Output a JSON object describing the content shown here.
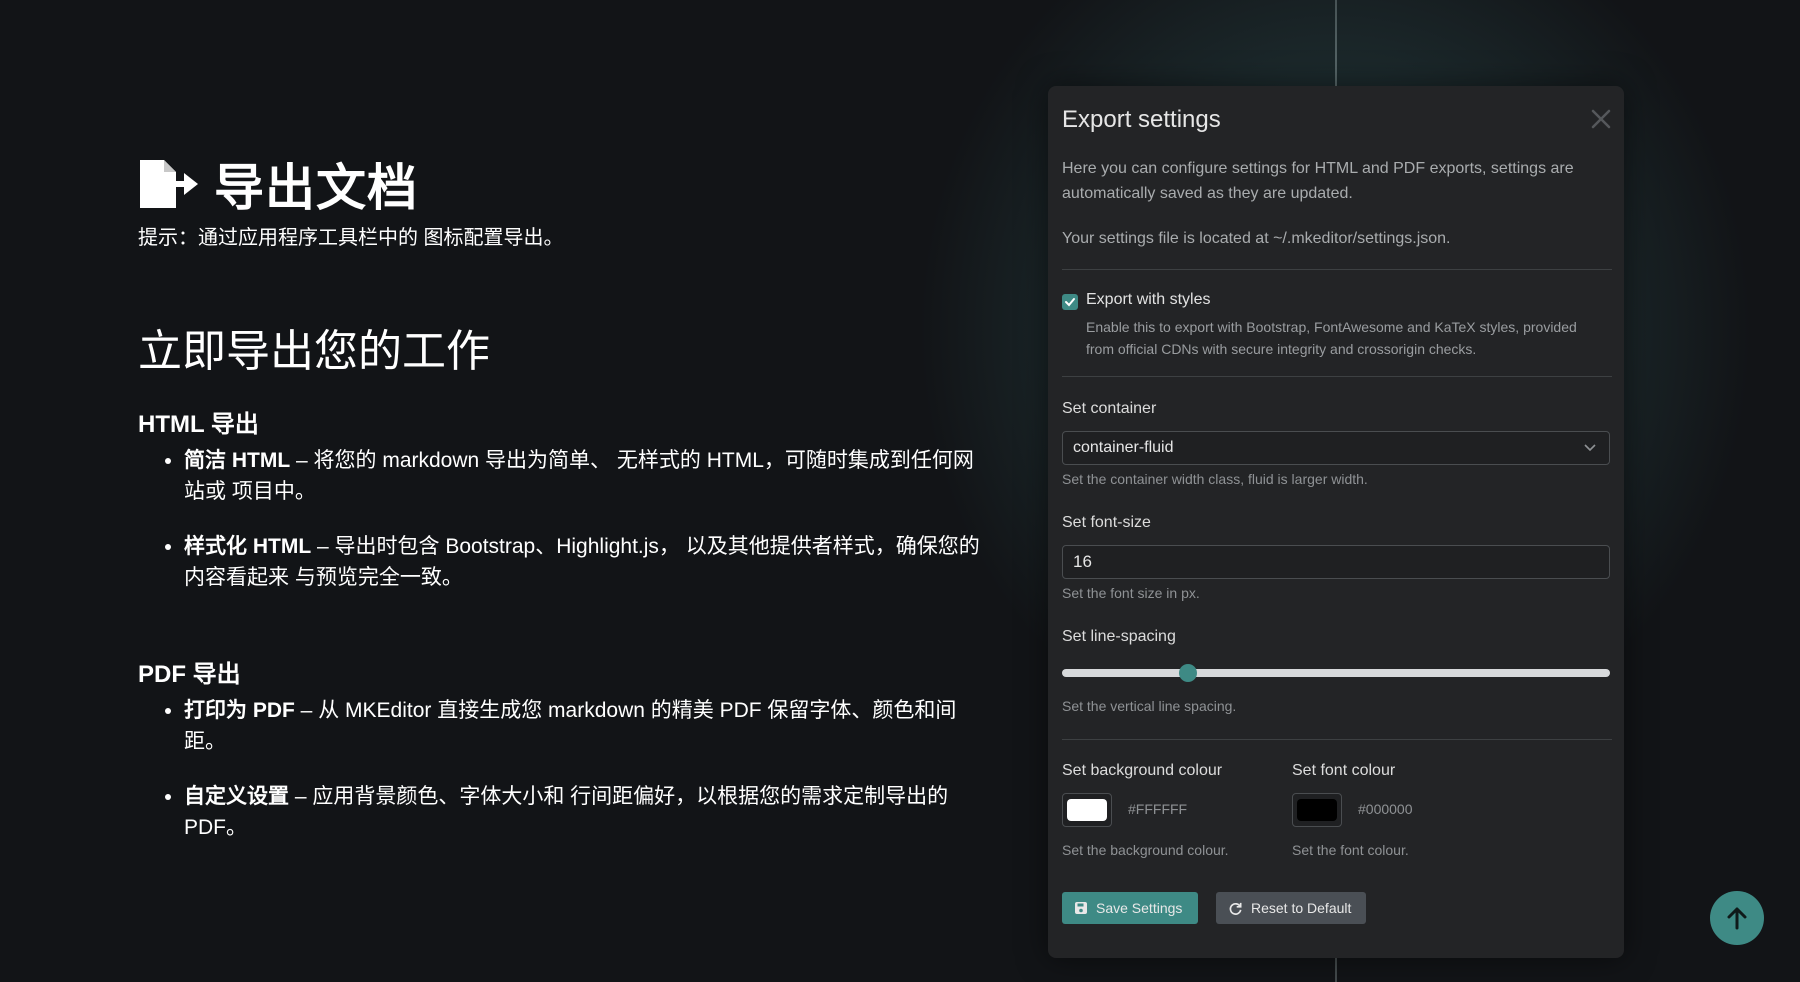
{
  "left": {
    "title": "导出文档",
    "hint": "提示：通过应用程序工具栏中的 图标配置导出。",
    "section_title": "立即导出您的工作",
    "html_export": {
      "heading": "HTML 导出",
      "items": [
        {
          "bold": "简洁 HTML",
          "text": " – 将您的 markdown 导出为简单、 无样式的 HTML，可随时集成到任何网站或 项目中。"
        },
        {
          "bold": "样式化 HTML",
          "text": " – 导出时包含 Bootstrap、Highlight.js， 以及其他提供者样式，确保您的内容看起来 与预览完全一致。"
        }
      ]
    },
    "pdf_export": {
      "heading": "PDF 导出",
      "items": [
        {
          "bold": "打印为 PDF",
          "text": " – 从 MKEditor 直接生成您 markdown 的精美 PDF 保留字体、颜色和间距。"
        },
        {
          "bold": "自定义设置",
          "text": " – 应用背景颜色、字体大小和 行间距偏好，以根据您的需求定制导出的 PDF。"
        }
      ]
    }
  },
  "modal": {
    "title": "Export settings",
    "description": "Here you can configure settings for HTML and PDF exports, settings are automatically saved as they are updated.",
    "settings_path_note": "Your settings file is located at ~/.mkeditor/settings.json.",
    "export_with_styles": {
      "label": "Export with styles",
      "checked": true,
      "help": "Enable this to export with Bootstrap, FontAwesome and KaTeX styles, provided from official CDNs with secure integrity and crossorigin checks."
    },
    "container": {
      "label": "Set container",
      "value": "container-fluid",
      "help": "Set the container width class, fluid is larger width."
    },
    "font_size": {
      "label": "Set font-size",
      "value": "16",
      "help": "Set the font size in px."
    },
    "line_spacing": {
      "label": "Set line-spacing",
      "fraction": 0.23,
      "help": "Set the vertical line spacing."
    },
    "background_colour": {
      "label": "Set background colour",
      "hex": "#FFFFFF",
      "help": "Set the background colour."
    },
    "font_colour": {
      "label": "Set font colour",
      "hex": "#000000",
      "help": "Set the font colour."
    },
    "save_label": "Save Settings",
    "reset_label": "Reset to Default"
  },
  "colors": {
    "accent": "#3e8a85",
    "background": "#121417",
    "modal_bg": "#232426"
  },
  "icons": {
    "title": "file-export-icon",
    "close": "close-icon",
    "save": "floppy-disk-icon",
    "reset": "refresh-icon",
    "scroll_top": "arrow-up-icon"
  }
}
